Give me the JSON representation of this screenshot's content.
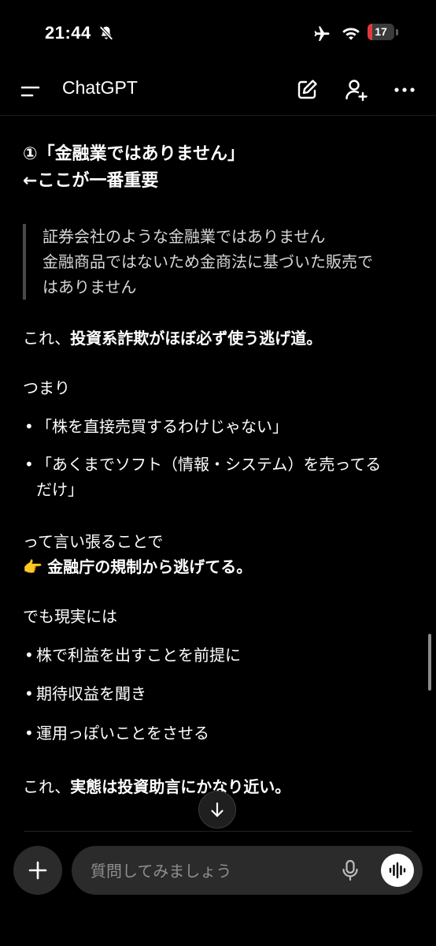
{
  "status": {
    "time": "21:44",
    "battery_level": "17",
    "battery_fill_percent": 17,
    "battery_fill_color": "#e03a3a",
    "icons": [
      "bell-slash-icon",
      "airplane-icon",
      "wifi-icon",
      "battery-icon"
    ]
  },
  "header": {
    "title": "ChatGPT",
    "icons": [
      "menu-icon",
      "new-chat-icon",
      "add-person-icon",
      "more-icon"
    ]
  },
  "message": {
    "heading_line1": "①「金融業ではありません」",
    "heading_line2": "←ここが一番重要",
    "quote_line1": "証券会社のような金融業ではありません",
    "quote_line2": "金融商品ではないため金商法に基づいた販売で",
    "quote_line3": "はありません",
    "p1_lead": "これ、",
    "p1_bold": "投資系詐欺がほぼ必ず使う逃げ道。",
    "p2": "つまり",
    "list1": [
      {
        "line1": "「株を直接売買するわけじゃない」",
        "line2": ""
      },
      {
        "line1": "「あくまでソフト（情報・システム）を売ってる",
        "line2": "だけ」"
      }
    ],
    "p3_line1": "って言い張ることで",
    "p3_emoji": "👉",
    "p3_bold": "金融庁の規制から逃げてる。",
    "p4": "でも現実には",
    "list2": [
      "株で利益を出すことを前提に",
      "期待収益を聞き",
      "運用っぽいことをさせる"
    ],
    "p5_lead": "これ、",
    "p5_bold": "実態は投資助言にかなり近い。",
    "bullet": "•"
  },
  "composer": {
    "placeholder": "質問してみましょう",
    "icons": [
      "plus-icon",
      "mic-icon",
      "voice-mode-icon",
      "arrow-down-icon"
    ]
  }
}
